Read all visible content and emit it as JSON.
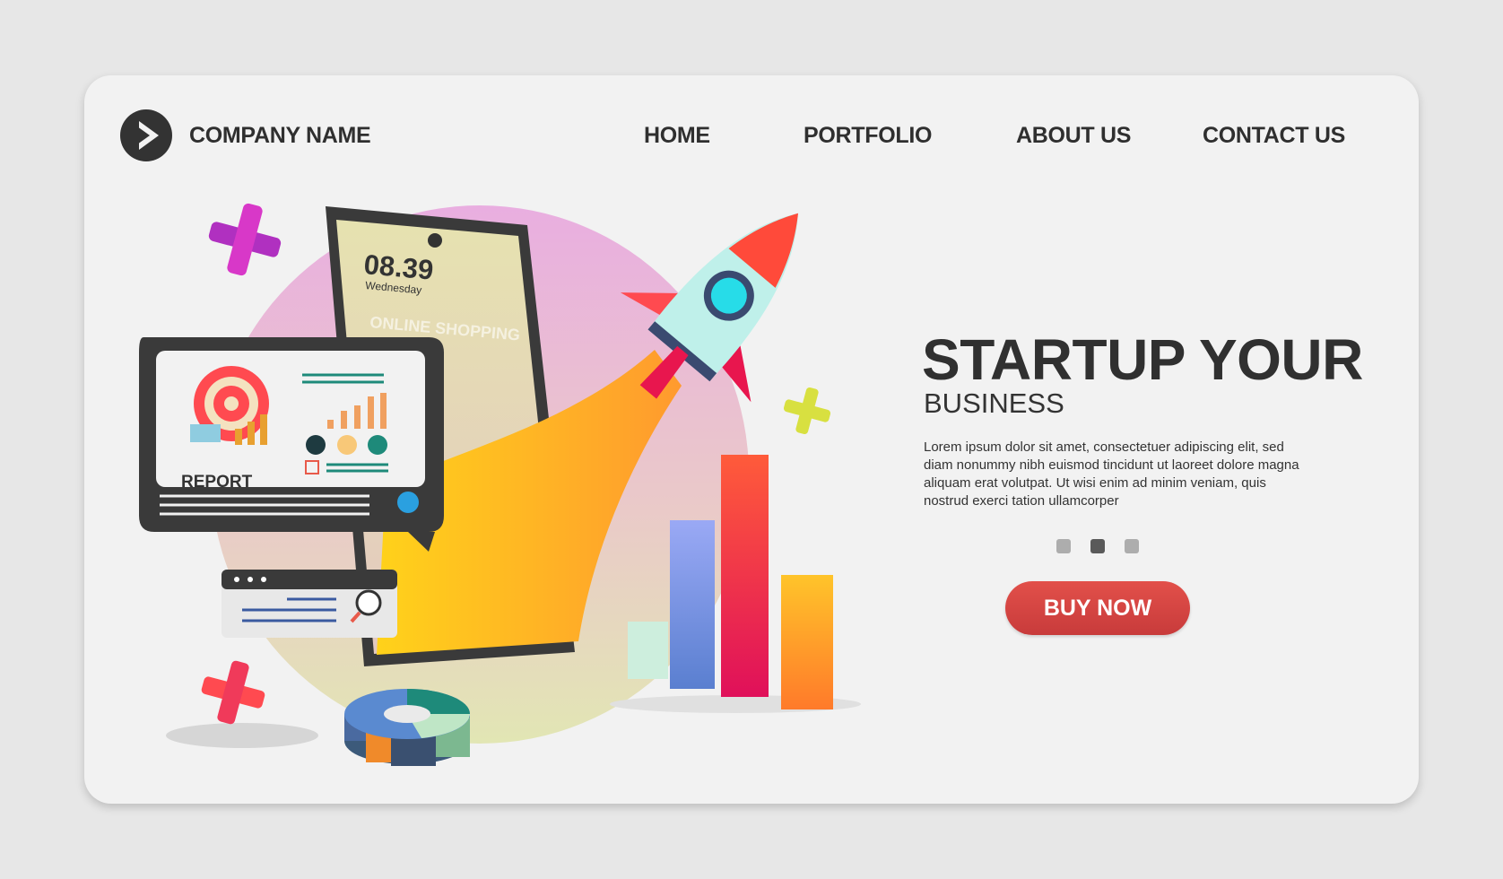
{
  "header": {
    "company_name": "COMPANY NAME",
    "nav": [
      "HOME",
      "PORTFOLIO",
      "ABOUT US",
      "CONTACT US"
    ]
  },
  "hero": {
    "title": "STARTUP YOUR",
    "subtitle": "BUSINESS",
    "body": "Lorem ipsum dolor sit amet, consectetuer adipiscing elit, sed diam nonummy nibh euismod tincidunt ut laoreet dolore magna aliquam erat volutpat. Ut wisi enim ad minim veniam, quis nostrud exerci tation ullamcorper",
    "carousel_active_index": 1,
    "cta": "BUY NOW"
  },
  "illustration": {
    "phone_time": "08.39",
    "phone_day": "Wednesday",
    "phone_label": "ONLINE SHOPPING",
    "report_label": "REPORT"
  },
  "colors": {
    "accent": "#d9443f",
    "text": "#2f2f2f",
    "card": "#f2f2f2",
    "background": "#e7e7e7"
  }
}
